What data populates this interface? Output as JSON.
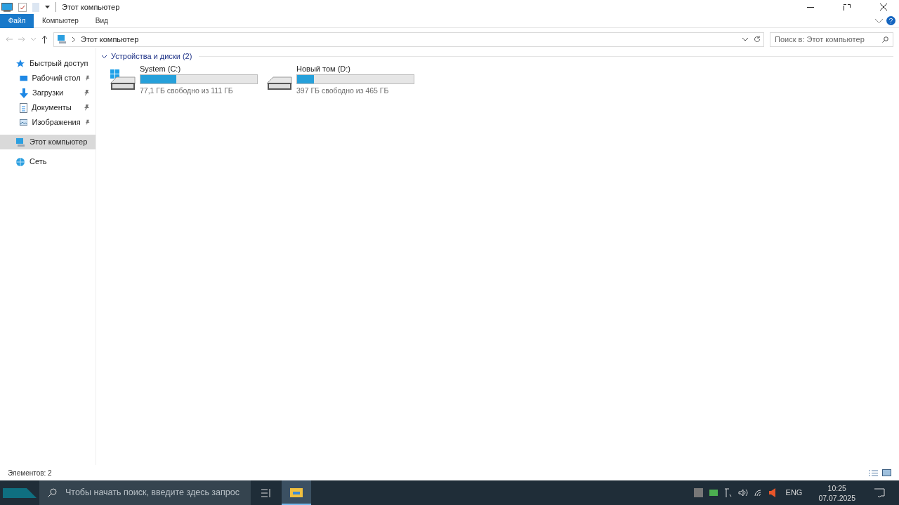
{
  "window": {
    "title": "Этот компьютер"
  },
  "ribbon_tabs": [
    {
      "label": "Файл",
      "kind": "file"
    },
    {
      "label": "Компьютер",
      "kind": "tab"
    },
    {
      "label": "Вид",
      "kind": "tab"
    }
  ],
  "address": {
    "path": "Этот компьютер"
  },
  "search": {
    "placeholder": "Поиск в: Этот компьютер"
  },
  "sidebar": {
    "items": [
      {
        "label": "Быстрый доступ",
        "kind": "star",
        "selected": false,
        "children": [
          {
            "label": "Рабочий стол",
            "kind": "desktop",
            "pinned": true,
            "selected": false
          },
          {
            "label": "Загрузки",
            "kind": "download",
            "pinned": true,
            "selected": false
          },
          {
            "label": "Документы",
            "kind": "document",
            "pinned": true,
            "selected": false
          },
          {
            "label": "Изображения",
            "kind": "picture",
            "pinned": true,
            "selected": false
          }
        ]
      },
      {
        "label": "Этот компьютер",
        "kind": "computer",
        "selected": true
      },
      {
        "label": "Сеть",
        "kind": "network",
        "selected": false
      }
    ]
  },
  "group": {
    "title": "Устройства и диски (2)",
    "expanded": true
  },
  "drives": [
    {
      "name": "System (C:)",
      "system": true,
      "level": 0.305,
      "info": "77,1 ГБ свободно из 111 ГБ"
    },
    {
      "name": "Новый том (D:)",
      "system": false,
      "level": 0.146,
      "info": "397 ГБ свободно из 465 ГБ"
    }
  ],
  "status_bar": {
    "text": "Элементов: 2"
  },
  "taskbar": {
    "search_placeholder": "Чтобы начать поиск, введите здесь запрос",
    "language": "ENG",
    "time": "10:25",
    "date": "07.07.2025"
  }
}
